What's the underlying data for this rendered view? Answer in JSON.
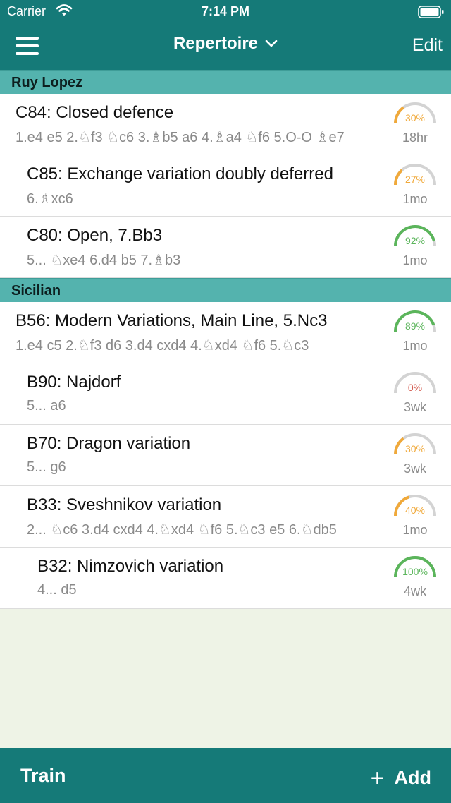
{
  "status": {
    "carrier": "Carrier",
    "time": "7:14 PM"
  },
  "nav": {
    "title": "Repertoire",
    "edit_label": "Edit",
    "menu_icon": "hamburger-icon"
  },
  "colors": {
    "brand": "#157a78",
    "section": "#54b3ae",
    "good": "#5bb55b",
    "medium": "#f0a93a",
    "bad": "#d35a4e",
    "track": "#d3d3d3"
  },
  "sections": [
    {
      "name": "Ruy Lopez",
      "rows": [
        {
          "title": "C84: Closed defence",
          "moves": "1.e4 e5 2.♘f3 ♘c6 3.♗b5 a6 4.♗a4 ♘f6 5.O-O ♗e7",
          "percent": "30%",
          "value": 30,
          "age": "18hr",
          "indent": 0
        },
        {
          "title": "C85: Exchange variation doubly deferred",
          "moves": "6.♗xc6",
          "percent": "27%",
          "value": 27,
          "age": "1mo",
          "indent": 1
        },
        {
          "title": "C80: Open, 7.Bb3",
          "moves": "5... ♘xe4 6.d4 b5 7.♗b3",
          "percent": "92%",
          "value": 92,
          "age": "1mo",
          "indent": 1
        }
      ]
    },
    {
      "name": "Sicilian",
      "rows": [
        {
          "title": "B56: Modern Variations, Main Line, 5.Nc3",
          "moves": "1.e4 c5 2.♘f3 d6 3.d4 cxd4 4.♘xd4 ♘f6 5.♘c3",
          "percent": "89%",
          "value": 89,
          "age": "1mo",
          "indent": 0
        },
        {
          "title": "B90: Najdorf",
          "moves": "5... a6",
          "percent": "0%",
          "value": 0,
          "age": "3wk",
          "indent": 1
        },
        {
          "title": "B70: Dragon variation",
          "moves": "5... g6",
          "percent": "30%",
          "value": 30,
          "age": "3wk",
          "indent": 1
        },
        {
          "title": "B33: Sveshnikov variation",
          "moves": "2... ♘c6 3.d4 cxd4 4.♘xd4 ♘f6 5.♘c3 e5 6.♘db5",
          "percent": "40%",
          "value": 40,
          "age": "1mo",
          "indent": 1
        },
        {
          "title": "B32: Nimzovich variation",
          "moves": "4... d5",
          "percent": "100%",
          "value": 100,
          "age": "4wk",
          "indent": 2
        }
      ]
    }
  ],
  "footer": {
    "train_label": "Train",
    "add_label": "Add",
    "add_icon": "plus-icon"
  }
}
